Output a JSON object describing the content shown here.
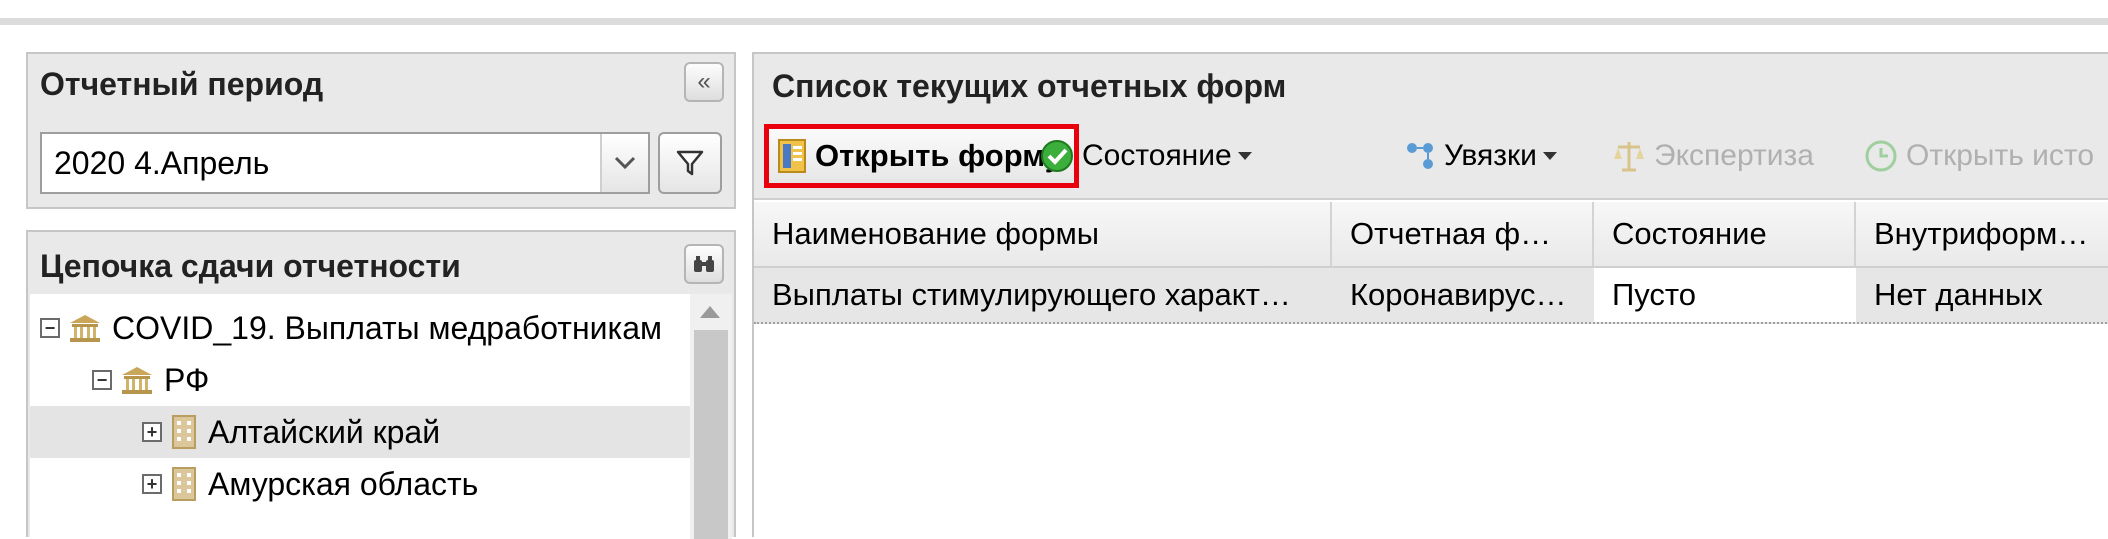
{
  "period_panel": {
    "title": "Отчетный период",
    "collapse_symbol": "«",
    "selected_period": "2020 4.Апрель"
  },
  "chain_panel": {
    "title": "Цепочка сдачи отчетности",
    "tree": [
      {
        "label": "COVID_19. Выплаты медработникам",
        "icon": "institution-icon",
        "selected": false
      },
      {
        "label": "РФ",
        "icon": "institution-icon",
        "selected": false
      },
      {
        "label": "Алтайский край",
        "icon": "building-icon",
        "selected": true
      },
      {
        "label": "Амурская область",
        "icon": "building-icon",
        "selected": false
      }
    ]
  },
  "forms_panel": {
    "title": "Список текущих отчетных форм",
    "toolbar": {
      "open_form": "Открыть форму",
      "state": "Состояние",
      "links": "Увязки",
      "expertise": "Экспертиза",
      "open_history": "Открыть исто"
    },
    "columns": [
      "Наименование формы",
      "Отчетная ф…",
      "Состояние",
      "Внутриформ…"
    ],
    "rows": [
      [
        "Выплаты стимулирующего характ…",
        "Коронавирус…",
        "Пусто",
        "Нет данных"
      ]
    ]
  },
  "colors": {
    "highlight_border": "#e8000c",
    "panel_bg": "#e9e9e9",
    "selected_row": "#e6e6e6"
  }
}
